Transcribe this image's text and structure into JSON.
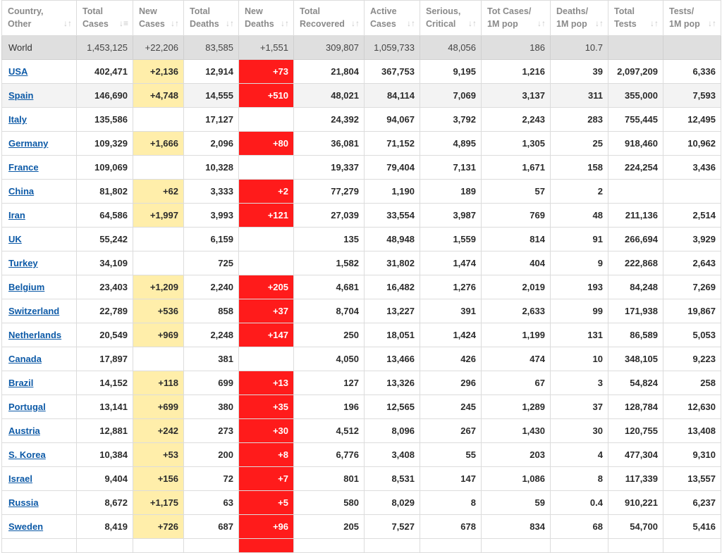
{
  "columns": [
    {
      "line1": "Country,",
      "line2": "Other"
    },
    {
      "line1": "Total",
      "line2": "Cases"
    },
    {
      "line1": "New",
      "line2": "Cases"
    },
    {
      "line1": "Total",
      "line2": "Deaths"
    },
    {
      "line1": "New",
      "line2": "Deaths"
    },
    {
      "line1": "Total",
      "line2": "Recovered"
    },
    {
      "line1": "Active",
      "line2": "Cases"
    },
    {
      "line1": "Serious,",
      "line2": "Critical"
    },
    {
      "line1": "Tot Cases/",
      "line2": "1M pop"
    },
    {
      "line1": "Deaths/",
      "line2": "1M pop"
    },
    {
      "line1": "Total",
      "line2": "Tests"
    },
    {
      "line1": "Tests/",
      "line2": "1M pop"
    }
  ],
  "sort_icon": "sort-arrows-icon",
  "sort_glyph": "↓↑",
  "sort_glyph_active": "↓≡",
  "world": [
    "World",
    "1,453,125",
    "+22,206",
    "83,585",
    "+1,551",
    "309,807",
    "1,059,733",
    "48,056",
    "186",
    "10.7",
    "",
    ""
  ],
  "rows": [
    [
      "USA",
      "402,471",
      "+2,136",
      "12,914",
      "+73",
      "21,804",
      "367,753",
      "9,195",
      "1,216",
      "39",
      "2,097,209",
      "6,336"
    ],
    [
      "Spain",
      "146,690",
      "+4,748",
      "14,555",
      "+510",
      "48,021",
      "84,114",
      "7,069",
      "3,137",
      "311",
      "355,000",
      "7,593"
    ],
    [
      "Italy",
      "135,586",
      "",
      "17,127",
      "",
      "24,392",
      "94,067",
      "3,792",
      "2,243",
      "283",
      "755,445",
      "12,495"
    ],
    [
      "Germany",
      "109,329",
      "+1,666",
      "2,096",
      "+80",
      "36,081",
      "71,152",
      "4,895",
      "1,305",
      "25",
      "918,460",
      "10,962"
    ],
    [
      "France",
      "109,069",
      "",
      "10,328",
      "",
      "19,337",
      "79,404",
      "7,131",
      "1,671",
      "158",
      "224,254",
      "3,436"
    ],
    [
      "China",
      "81,802",
      "+62",
      "3,333",
      "+2",
      "77,279",
      "1,190",
      "189",
      "57",
      "2",
      "",
      ""
    ],
    [
      "Iran",
      "64,586",
      "+1,997",
      "3,993",
      "+121",
      "27,039",
      "33,554",
      "3,987",
      "769",
      "48",
      "211,136",
      "2,514"
    ],
    [
      "UK",
      "55,242",
      "",
      "6,159",
      "",
      "135",
      "48,948",
      "1,559",
      "814",
      "91",
      "266,694",
      "3,929"
    ],
    [
      "Turkey",
      "34,109",
      "",
      "725",
      "",
      "1,582",
      "31,802",
      "1,474",
      "404",
      "9",
      "222,868",
      "2,643"
    ],
    [
      "Belgium",
      "23,403",
      "+1,209",
      "2,240",
      "+205",
      "4,681",
      "16,482",
      "1,276",
      "2,019",
      "193",
      "84,248",
      "7,269"
    ],
    [
      "Switzerland",
      "22,789",
      "+536",
      "858",
      "+37",
      "8,704",
      "13,227",
      "391",
      "2,633",
      "99",
      "171,938",
      "19,867"
    ],
    [
      "Netherlands",
      "20,549",
      "+969",
      "2,248",
      "+147",
      "250",
      "18,051",
      "1,424",
      "1,199",
      "131",
      "86,589",
      "5,053"
    ],
    [
      "Canada",
      "17,897",
      "",
      "381",
      "",
      "4,050",
      "13,466",
      "426",
      "474",
      "10",
      "348,105",
      "9,223"
    ],
    [
      "Brazil",
      "14,152",
      "+118",
      "699",
      "+13",
      "127",
      "13,326",
      "296",
      "67",
      "3",
      "54,824",
      "258"
    ],
    [
      "Portugal",
      "13,141",
      "+699",
      "380",
      "+35",
      "196",
      "12,565",
      "245",
      "1,289",
      "37",
      "128,784",
      "12,630"
    ],
    [
      "Austria",
      "12,881",
      "+242",
      "273",
      "+30",
      "4,512",
      "8,096",
      "267",
      "1,430",
      "30",
      "120,755",
      "13,408"
    ],
    [
      "S. Korea",
      "10,384",
      "+53",
      "200",
      "+8",
      "6,776",
      "3,408",
      "55",
      "203",
      "4",
      "477,304",
      "9,310"
    ],
    [
      "Israel",
      "9,404",
      "+156",
      "72",
      "+7",
      "801",
      "8,531",
      "147",
      "1,086",
      "8",
      "117,339",
      "13,557"
    ],
    [
      "Russia",
      "8,672",
      "+1,175",
      "63",
      "+5",
      "580",
      "8,029",
      "8",
      "59",
      "0.4",
      "910,221",
      "6,237"
    ],
    [
      "Sweden",
      "8,419",
      "+726",
      "687",
      "+96",
      "205",
      "7,527",
      "678",
      "834",
      "68",
      "54,700",
      "5,416"
    ]
  ],
  "colors": {
    "new_cases_highlight": "#ffeeaa",
    "new_deaths_highlight": "#ff1b1b",
    "link": "#0d5aa7"
  }
}
